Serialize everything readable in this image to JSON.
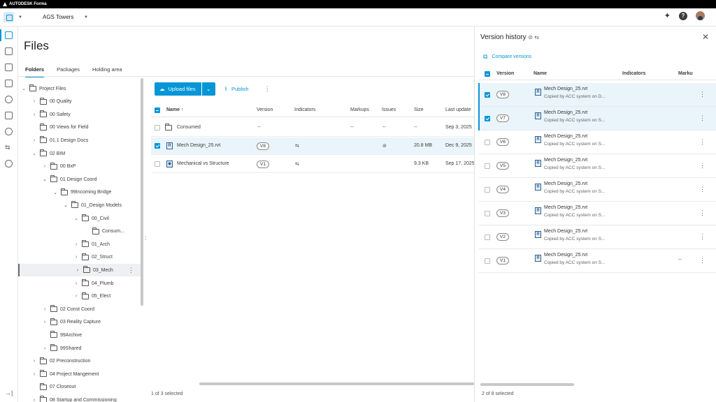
{
  "brand": {
    "label": "AUTODESK Forma"
  },
  "header": {
    "project": "AGS Towers"
  },
  "page": {
    "title": "Files"
  },
  "tabs": [
    "Folders",
    "Packages",
    "Holding area"
  ],
  "tree": [
    {
      "label": "Project Files",
      "indent": 0,
      "chev": "⌄"
    },
    {
      "label": "00 Quality",
      "indent": 1,
      "chev": "›"
    },
    {
      "label": "00 Safety",
      "indent": 1,
      "chev": "›"
    },
    {
      "label": "00 Views for Field",
      "indent": 1,
      "chev": ""
    },
    {
      "label": "01.1 Design Docs",
      "indent": 1,
      "chev": "›"
    },
    {
      "label": "02 BIM",
      "indent": 1,
      "chev": "⌄"
    },
    {
      "label": "00 BxP",
      "indent": 2,
      "chev": "›"
    },
    {
      "label": "01 Design Coord",
      "indent": 2,
      "chev": "⌄"
    },
    {
      "label": "99Incoming Bridge",
      "indent": 3,
      "chev": "⌄"
    },
    {
      "label": "01_Design Models",
      "indent": 4,
      "chev": "⌄"
    },
    {
      "label": "00_Civil",
      "indent": 5,
      "chev": "⌄"
    },
    {
      "label": "Consum...",
      "indent": 6,
      "chev": ""
    },
    {
      "label": "01_Arch",
      "indent": 5,
      "chev": "›"
    },
    {
      "label": "02_Struct",
      "indent": 5,
      "chev": "›"
    },
    {
      "label": "03_Mech",
      "indent": 5,
      "chev": "›"
    },
    {
      "label": "04_Plumb",
      "indent": 5,
      "chev": "›"
    },
    {
      "label": "05_Elect",
      "indent": 5,
      "chev": "›"
    },
    {
      "label": "02 Const Coord",
      "indent": 2,
      "chev": "›"
    },
    {
      "label": "03 Reality Capture",
      "indent": 2,
      "chev": "›"
    },
    {
      "label": "99Archive",
      "indent": 2,
      "chev": ""
    },
    {
      "label": "99Shared",
      "indent": 2,
      "chev": "›"
    },
    {
      "label": "02 Preconstruction",
      "indent": 1,
      "chev": "›"
    },
    {
      "label": "04 Project Mangement",
      "indent": 1,
      "chev": "›"
    },
    {
      "label": "07 Closeout",
      "indent": 1,
      "chev": ""
    },
    {
      "label": "08 Startup and Commissioning",
      "indent": 1,
      "chev": "›"
    }
  ],
  "toolbar": {
    "upload": "Upload files",
    "publish": "Publish"
  },
  "files": {
    "columns": [
      "Name",
      "Version",
      "Indicators",
      "Markups",
      "Issues",
      "Size",
      "Last update"
    ],
    "rows": [
      {
        "name": "Consumed",
        "version": "--",
        "indicators": "",
        "markups": "--",
        "issues": "--",
        "size": "--",
        "updated": "Sep 3, 2025",
        "type": "folder",
        "selected": false
      },
      {
        "name": "Mech Design_25.rvt",
        "version": "V8",
        "indicators": "⇆",
        "markups": "",
        "issues": "⊘",
        "size": "20.8 MB",
        "updated": "Dec 9, 2025",
        "type": "rvt",
        "selected": true
      },
      {
        "name": "Mechanical vs Structure",
        "version": "V1",
        "indicators": "⇆",
        "markups": "",
        "issues": "",
        "size": "9.3 KB",
        "updated": "Sep 17, 2025",
        "type": "model",
        "selected": false
      }
    ],
    "status": "1 of 3 selected"
  },
  "panel": {
    "title": "Version history",
    "compare": "Compare versions",
    "columns": [
      "Version",
      "Name",
      "Indicators",
      "Marku"
    ],
    "versions": [
      {
        "v": "V8",
        "name": "Mech Design_25.rvt",
        "sub": "Copied by ACC system on D...",
        "ind": "",
        "checked": true
      },
      {
        "v": "V7",
        "name": "Mech Design_25.rvt",
        "sub": "Copied by ACC system on S...",
        "ind": "",
        "checked": true
      },
      {
        "v": "V6",
        "name": "Mech Design_25.rvt",
        "sub": "Copied by ACC system on S...",
        "ind": "",
        "checked": false
      },
      {
        "v": "V5",
        "name": "Mech Design_25.rvt",
        "sub": "Copied by ACC system on S...",
        "ind": "",
        "checked": false
      },
      {
        "v": "V4",
        "name": "Mech Design_25.rvt",
        "sub": "Copied by ACC system on S...",
        "ind": "",
        "checked": false
      },
      {
        "v": "V3",
        "name": "Mech Design_25.rvt",
        "sub": "Copied by ACC system on S...",
        "ind": "",
        "checked": false
      },
      {
        "v": "V2",
        "name": "Mech Design_25.rvt",
        "sub": "Copied by ACC system on S...",
        "ind": "",
        "checked": false
      },
      {
        "v": "V1",
        "name": "Mech Design_25.rvt",
        "sub": "Copied by ACC system on S...",
        "ind": "--",
        "checked": false
      }
    ],
    "status": "2 of 8 selected"
  }
}
